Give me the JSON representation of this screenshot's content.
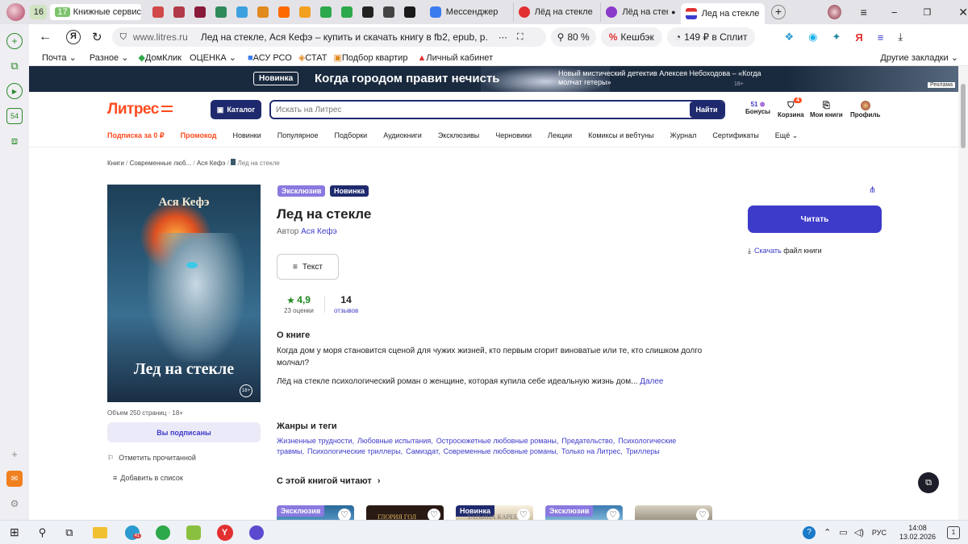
{
  "tabs": [
    {
      "label": "16",
      "color": "#d9e8c9"
    },
    {
      "label": "17",
      "sub": "Книжные сервис",
      "color": "#7cc46c"
    },
    {
      "label": "",
      "color": "#d04848"
    },
    {
      "label": "",
      "color": "#b03a48"
    },
    {
      "label": "",
      "color": "#8a1a3a"
    },
    {
      "label": "",
      "color": "#2e8a5a"
    },
    {
      "label": "",
      "color": "#3fa0e0"
    },
    {
      "label": "",
      "color": "#e08a20"
    },
    {
      "label": "",
      "color": "#ff6a00"
    },
    {
      "label": "",
      "color": "#f2a020"
    },
    {
      "label": "",
      "color": "#2da84a"
    },
    {
      "label": "",
      "color": "#2da84a"
    },
    {
      "label": "",
      "color": "#222"
    },
    {
      "label": "",
      "color": "#444"
    },
    {
      "label": "",
      "color": "#1a1a1a"
    },
    {
      "label": "Мессенджер",
      "color": "#3b7bf0"
    },
    {
      "label": "Лёд на стекле к",
      "color": "#e23030"
    },
    {
      "label": "Лёд на стекле",
      "color": "#8a3cc8"
    },
    {
      "label": "Лед на стекле",
      "color": "#3b3bd0",
      "active": true
    }
  ],
  "address": {
    "domain": "www.litres.ru",
    "title": "Лед на стекле, Ася Кефэ – купить и скачать книгу в fb2, epub, р...",
    "zoom": "80 %",
    "cashback": "Кешбэк",
    "split": "149 ₽ в Сплит"
  },
  "bookmarks": [
    "Почта",
    "Разное",
    "ДомКлик",
    "ОЦЕНКА",
    "АСУ РСО",
    "СТАТ",
    "Подбор квартир",
    "Личный кабинет",
    "Другие закладки"
  ],
  "banner": {
    "badge": "Новинка",
    "headline": "Когда городом правит нечисть",
    "desc": "Новый мистический детектив Алексея Небоходова – «Когда молчат гетеры»",
    "age": "18+",
    "ad": "Реклама"
  },
  "header": {
    "logo": "Литрес",
    "catalog": "Каталог",
    "search_placeholder": "Искать на Литрес",
    "search_btn": "Найти",
    "bonus_count": "51",
    "bonus": "Бонусы",
    "cart": "Корзина",
    "cart_badge": "4",
    "mybooks": "Мои книги",
    "profile": "Профиль"
  },
  "nav": [
    "Подписка за 0 ₽",
    "Промокод",
    "Новинки",
    "Популярное",
    "Подборки",
    "Аудиокниги",
    "Эксклюзивы",
    "Черновики",
    "Лекции",
    "Комиксы и вебтуны",
    "Журнал",
    "Сертификаты",
    "Ещё"
  ],
  "breadcrumb": [
    "Книги",
    "Современные люб...",
    "Ася Кефэ",
    "Лед на стекле"
  ],
  "book": {
    "cover_author": "Ася Кефэ",
    "cover_title": "Лед на стекле",
    "cover_age": "18+",
    "tag1": "Эксклюзив",
    "tag2": "Новинка",
    "title": "Лед на стекле",
    "author_label": "Автор",
    "author": "Ася Кефэ",
    "format": "Текст",
    "rating": "4,9",
    "rating_count": "23 оценки",
    "reviews": "14",
    "reviews_label": "отзывов",
    "meta": "Объем 250 страниц",
    "age": "18+",
    "subscribed": "Вы подписаны",
    "mark_read": "Отметить прочитанной",
    "add_list": "Добавить в список",
    "read": "Читать",
    "download": "Скачать",
    "download_rest": "файл книги"
  },
  "about": {
    "heading": "О книге",
    "p1": "Когда дом у моря становится сценой для чужих жизней, кто первым сгорит виноватые или те, кто слишком долго молчал?",
    "p2": "Лёд на стекле психологический роман о женщине, которая купила себе идеальную жизнь дом...",
    "more": "Далее"
  },
  "genres": {
    "heading": "Жанры и теги",
    "items": [
      "Жизненные трудности,",
      "Любовные испытания,",
      "Остросюжетные любовные романы,",
      "Предательство,",
      "Психологические травмы,",
      "Психологические триллеры,",
      "Самиздат,",
      "Современные любовные романы,",
      "Только на Литрес,",
      "Триллеры"
    ]
  },
  "also": {
    "heading": "С этой книгой читают",
    "thumbs": [
      {
        "tag": "Эксклюзив",
        "text": ""
      },
      {
        "tag": "",
        "text": "ГЛОРИЯ ГОЛ"
      },
      {
        "tag": "Новинка",
        "text": "ТАТЬЯНА КАРЕЕВА"
      },
      {
        "tag": "Эксклюзив",
        "text": ""
      },
      {
        "tag": "",
        "text": ""
      }
    ]
  },
  "taskbar": {
    "tg_badge": "41",
    "lang": "РУС",
    "time": "14:08",
    "date": "13.02.2026",
    "notif": "1"
  },
  "rail": {
    "badge": "54"
  },
  "colors": {
    "brand": "#3d3bc9",
    "accent": "#ff4b1f",
    "green": "#1b8a1b"
  }
}
